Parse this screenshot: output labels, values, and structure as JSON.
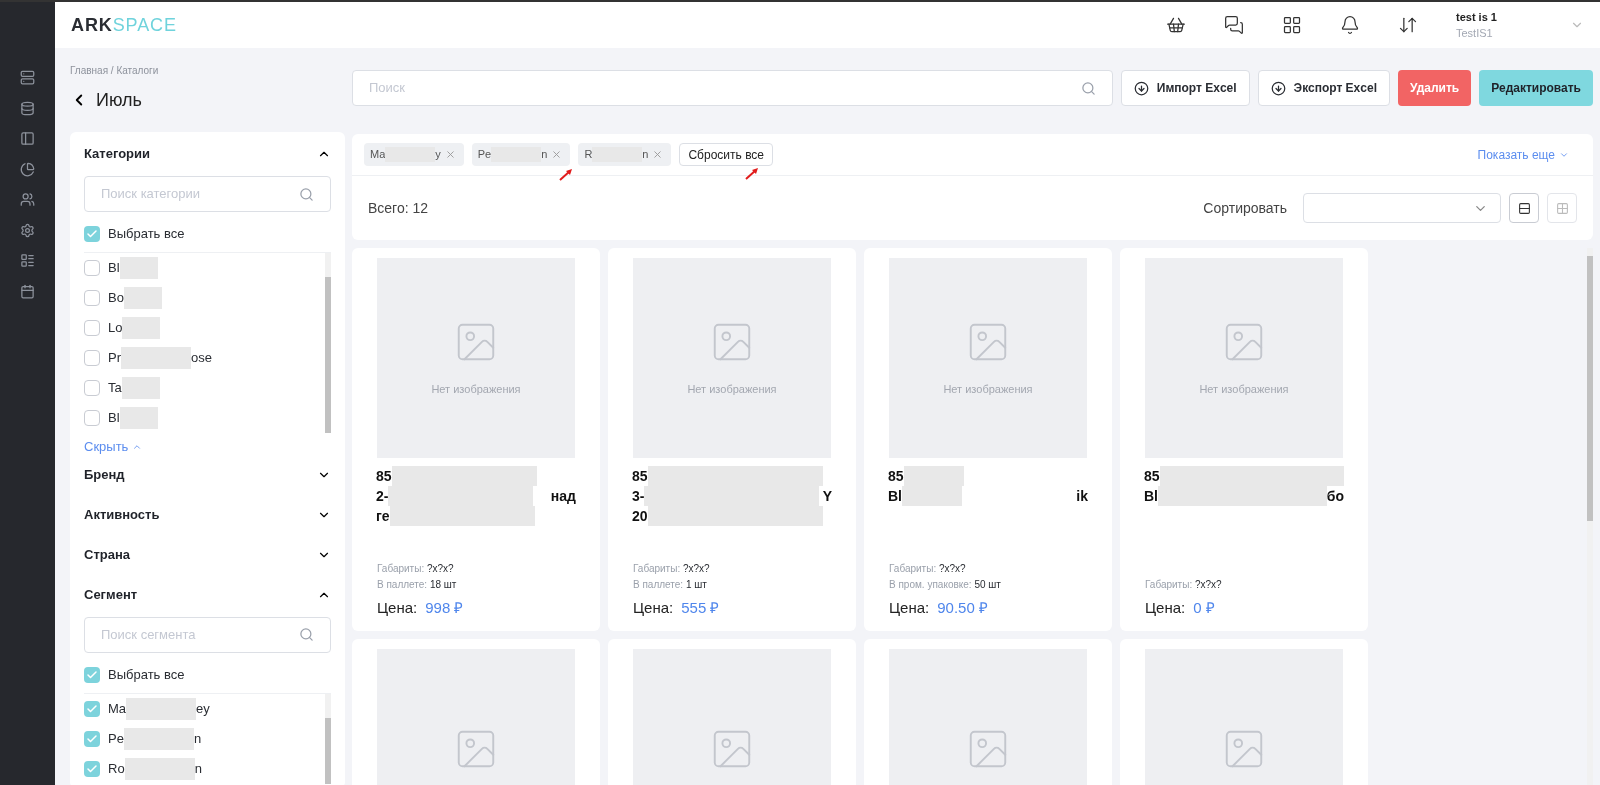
{
  "header": {
    "logo": [
      "ARK",
      "SPACE"
    ],
    "user": {
      "name": "test is 1",
      "login": "TestIS1"
    }
  },
  "breadcrumb": "Главная / Каталоги",
  "title": "Июль",
  "search": {
    "placeholder": "Поиск"
  },
  "actions": [
    {
      "label": "Импорт Excel",
      "kind": "outline"
    },
    {
      "label": "Экспорт Excel",
      "kind": "outline"
    },
    {
      "label": "Удалить",
      "kind": "danger"
    },
    {
      "label": "Редактировать",
      "kind": "primary"
    }
  ],
  "filters": [
    {
      "title": "Категории",
      "expanded": true,
      "placeholder": "Поиск категории",
      "select_all": {
        "label": "Выбрать все",
        "checked": true
      },
      "toggle": "Скрыть",
      "items": [
        {
          "start": "Bl",
          "checked": false
        },
        {
          "start": "Bo",
          "checked": false
        },
        {
          "start": "Lo",
          "checked": false
        },
        {
          "start": "Pr",
          "end": "ose",
          "checked": false
        },
        {
          "start": "Ta",
          "checked": false
        },
        {
          "start": "Bl",
          "checked": false
        }
      ]
    },
    {
      "title": "Бренд",
      "expanded": false
    },
    {
      "title": "Активность",
      "expanded": false
    },
    {
      "title": "Страна",
      "expanded": false
    },
    {
      "title": "Сегмент",
      "expanded": true,
      "placeholder": "Поиск сегмента",
      "select_all": {
        "label": "Выбрать все",
        "checked": true
      },
      "items": [
        {
          "start": "Ma",
          "end": "ey",
          "checked": true
        },
        {
          "start": "Pe",
          "end": "n",
          "checked": true
        },
        {
          "start": "Ro",
          "end": "n",
          "checked": true
        }
      ]
    }
  ],
  "chips": [
    {
      "start": "Ma",
      "end": "y",
      "marked": false
    },
    {
      "start": "Pe",
      "end": "n",
      "marked": true
    },
    {
      "start": "R",
      "end": "n",
      "marked": false
    }
  ],
  "reset": {
    "label": "Сбросить все",
    "marked": true
  },
  "show_more": "Показать еще",
  "total": "Всего: 12",
  "sort_label": "Сортировать",
  "view_modes": [
    {
      "kind": "list",
      "selected": true
    },
    {
      "kind": "grid",
      "selected": false
    }
  ],
  "products": [
    {
      "kind": "full",
      "image_text": "Нет изображения",
      "lines": [
        {
          "start": "85"
        },
        {
          "start": "2-",
          "end": "над"
        },
        {
          "start": "ге"
        }
      ],
      "specs": [
        {
          "label": "Габариты:",
          "value": "?x?x?"
        },
        {
          "label": "В паллете:",
          "value": "18 шт"
        }
      ],
      "price_label": "Цена:",
      "price": "998 ₽"
    },
    {
      "kind": "full",
      "image_text": "Нет изображения",
      "lines": [
        {
          "start": "85"
        },
        {
          "start": "3-",
          "end": "Y"
        },
        {
          "start": "20"
        }
      ],
      "specs": [
        {
          "label": "Габариты:",
          "value": "?x?x?"
        },
        {
          "label": "В паллете:",
          "value": "1 шт"
        }
      ],
      "price_label": "Цена:",
      "price": "555 ₽"
    },
    {
      "kind": "full",
      "image_text": "Нет изображения",
      "lines": [
        {
          "start": "85"
        },
        {
          "start": "Bl",
          "end": "ik"
        }
      ],
      "specs": [
        {
          "label": "Габариты:",
          "value": "?x?x?"
        },
        {
          "label": "В пром. упаковке:",
          "value": "50 шт"
        }
      ],
      "price_label": "Цена:",
      "price": "90.50 ₽"
    },
    {
      "kind": "full",
      "image_text": "Нет изображения",
      "lines": [
        {
          "start": "85"
        },
        {
          "start": "Bl",
          "end": "бо"
        }
      ],
      "specs": [
        {
          "label": "Габариты:",
          "value": "?x?x?"
        }
      ],
      "price_label": "Цена:",
      "price": "0 ₽"
    },
    {
      "kind": "image_only"
    },
    {
      "kind": "image_only"
    },
    {
      "kind": "image_only"
    },
    {
      "kind": "image_only"
    }
  ]
}
